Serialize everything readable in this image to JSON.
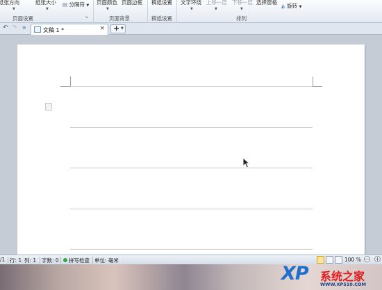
{
  "ribbon": {
    "items": [
      "纸张方向",
      "纸张大小",
      "分隔符",
      "页面颜色",
      "页面边框",
      "稿纸设置",
      "文字环绕",
      "上移一层",
      "下移一层",
      "选择窗格",
      "旋转"
    ],
    "groups": [
      "页面设置",
      "页面背景",
      "稿纸设置",
      "排列"
    ]
  },
  "tabs": {
    "doc_title": "文稿 1 *",
    "close": "×",
    "new_tab": "+"
  },
  "status": {
    "page": "/1",
    "row": "行: 1",
    "col": "列: 1",
    "words": "字数: 0",
    "spell": "拼写检查",
    "unit": "单位: 毫米",
    "zoom": "100 %"
  },
  "watermark": {
    "xp": "XP",
    "brand": "系统之家",
    "url": "WWW.XP510.COM"
  }
}
